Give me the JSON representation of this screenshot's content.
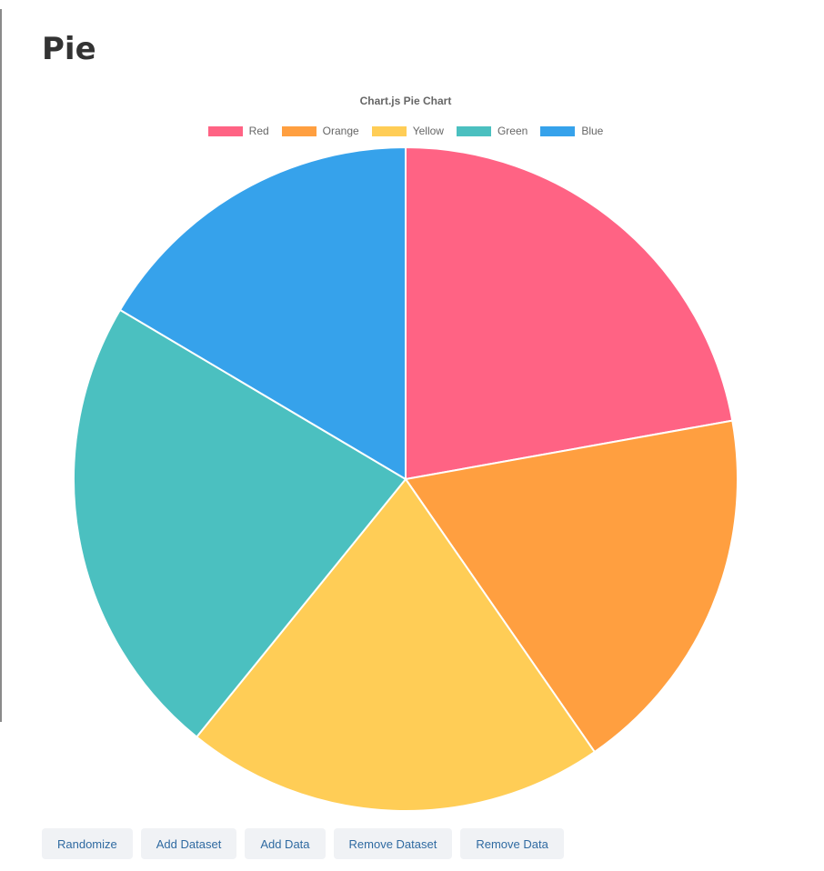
{
  "page": {
    "title": "Pie"
  },
  "chart_data": {
    "type": "pie",
    "title": "Chart.js Pie Chart",
    "legend_position": "top",
    "categories": [
      "Red",
      "Orange",
      "Yellow",
      "Green",
      "Blue"
    ],
    "series": [
      {
        "values": [
          22.2,
          18.2,
          20.5,
          22.7,
          16.5
        ]
      }
    ],
    "colors": [
      "#ff6384",
      "#ff9f40",
      "#ffcd56",
      "#4bc0c0",
      "#36a2eb"
    ],
    "border_color": "#ffffff"
  },
  "buttons": [
    {
      "label": "Randomize"
    },
    {
      "label": "Add Dataset"
    },
    {
      "label": "Add Data"
    },
    {
      "label": "Remove Dataset"
    },
    {
      "label": "Remove Data"
    }
  ]
}
